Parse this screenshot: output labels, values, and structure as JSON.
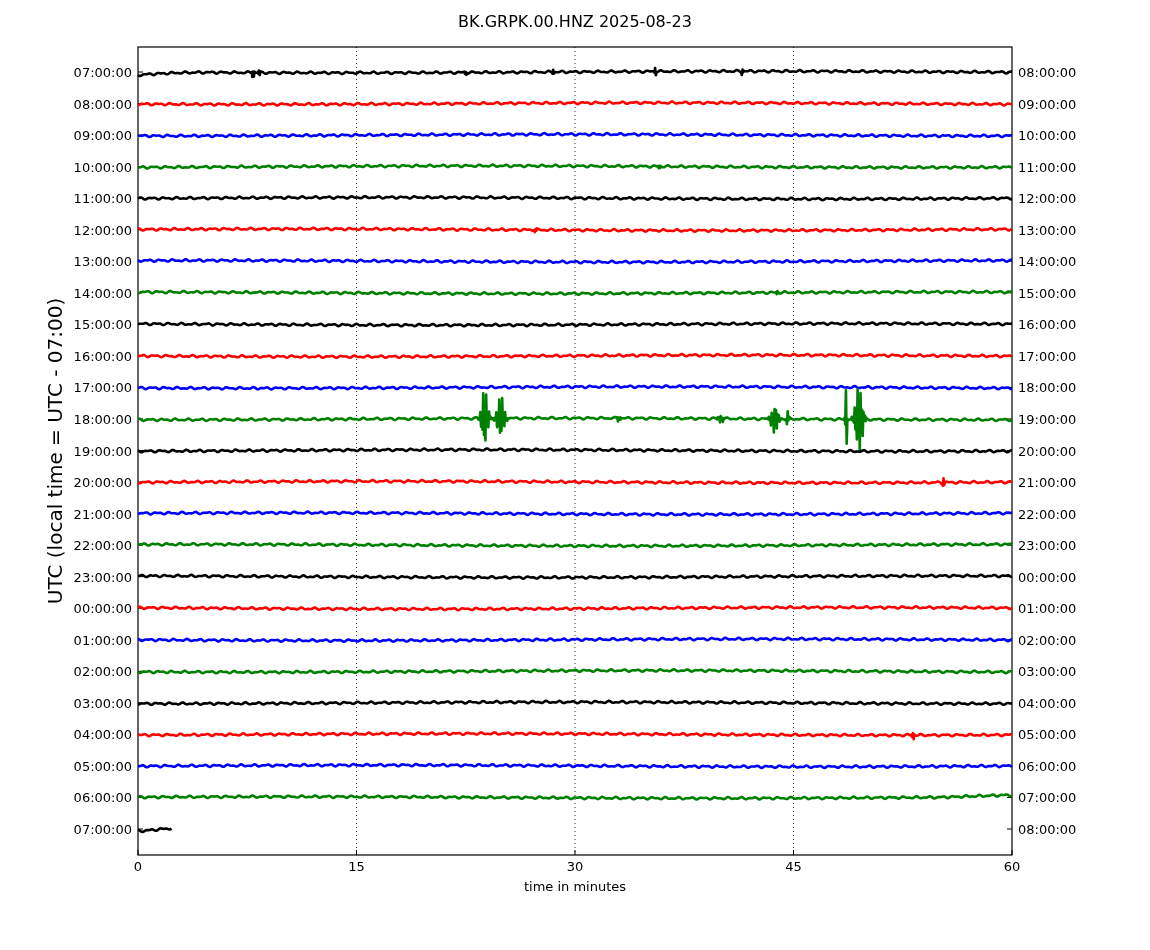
{
  "chart": {
    "title": "BK.GRPK.00.HNZ 2025-08-23",
    "xlabel": "time in minutes",
    "ylabel": "UTC (local time = UTC - 07:00)",
    "xticks": [
      "0",
      "15",
      "30",
      "45",
      "60"
    ],
    "rows": [
      {
        "left": "07:00:00",
        "right": "08:00:00",
        "color": "#000000",
        "kind": "full"
      },
      {
        "left": "08:00:00",
        "right": "09:00:00",
        "color": "#ff0000",
        "kind": "full"
      },
      {
        "left": "09:00:00",
        "right": "10:00:00",
        "color": "#0000ff",
        "kind": "full"
      },
      {
        "left": "10:00:00",
        "right": "11:00:00",
        "color": "#008000",
        "kind": "full"
      },
      {
        "left": "11:00:00",
        "right": "12:00:00",
        "color": "#000000",
        "kind": "full"
      },
      {
        "left": "12:00:00",
        "right": "13:00:00",
        "color": "#ff0000",
        "kind": "full"
      },
      {
        "left": "13:00:00",
        "right": "14:00:00",
        "color": "#0000ff",
        "kind": "full"
      },
      {
        "left": "14:00:00",
        "right": "15:00:00",
        "color": "#008000",
        "kind": "full"
      },
      {
        "left": "15:00:00",
        "right": "16:00:00",
        "color": "#000000",
        "kind": "full"
      },
      {
        "left": "16:00:00",
        "right": "17:00:00",
        "color": "#ff0000",
        "kind": "full"
      },
      {
        "left": "17:00:00",
        "right": "18:00:00",
        "color": "#0000ff",
        "kind": "full"
      },
      {
        "left": "18:00:00",
        "right": "19:00:00",
        "color": "#008000",
        "kind": "full"
      },
      {
        "left": "19:00:00",
        "right": "20:00:00",
        "color": "#000000",
        "kind": "full"
      },
      {
        "left": "20:00:00",
        "right": "21:00:00",
        "color": "#ff0000",
        "kind": "full"
      },
      {
        "left": "21:00:00",
        "right": "22:00:00",
        "color": "#0000ff",
        "kind": "full"
      },
      {
        "left": "22:00:00",
        "right": "23:00:00",
        "color": "#008000",
        "kind": "full"
      },
      {
        "left": "23:00:00",
        "right": "00:00:00",
        "color": "#000000",
        "kind": "full"
      },
      {
        "left": "00:00:00",
        "right": "01:00:00",
        "color": "#ff0000",
        "kind": "full"
      },
      {
        "left": "01:00:00",
        "right": "02:00:00",
        "color": "#0000ff",
        "kind": "full"
      },
      {
        "left": "02:00:00",
        "right": "03:00:00",
        "color": "#008000",
        "kind": "full"
      },
      {
        "left": "03:00:00",
        "right": "04:00:00",
        "color": "#000000",
        "kind": "full"
      },
      {
        "left": "04:00:00",
        "right": "05:00:00",
        "color": "#ff0000",
        "kind": "full"
      },
      {
        "left": "05:00:00",
        "right": "06:00:00",
        "color": "#0000ff",
        "kind": "full"
      },
      {
        "left": "06:00:00",
        "right": "07:00:00",
        "color": "#008000",
        "kind": "full"
      },
      {
        "left": "07:00:00",
        "right": "08:00:00",
        "color": "#000000",
        "kind": "partial"
      }
    ]
  }
}
